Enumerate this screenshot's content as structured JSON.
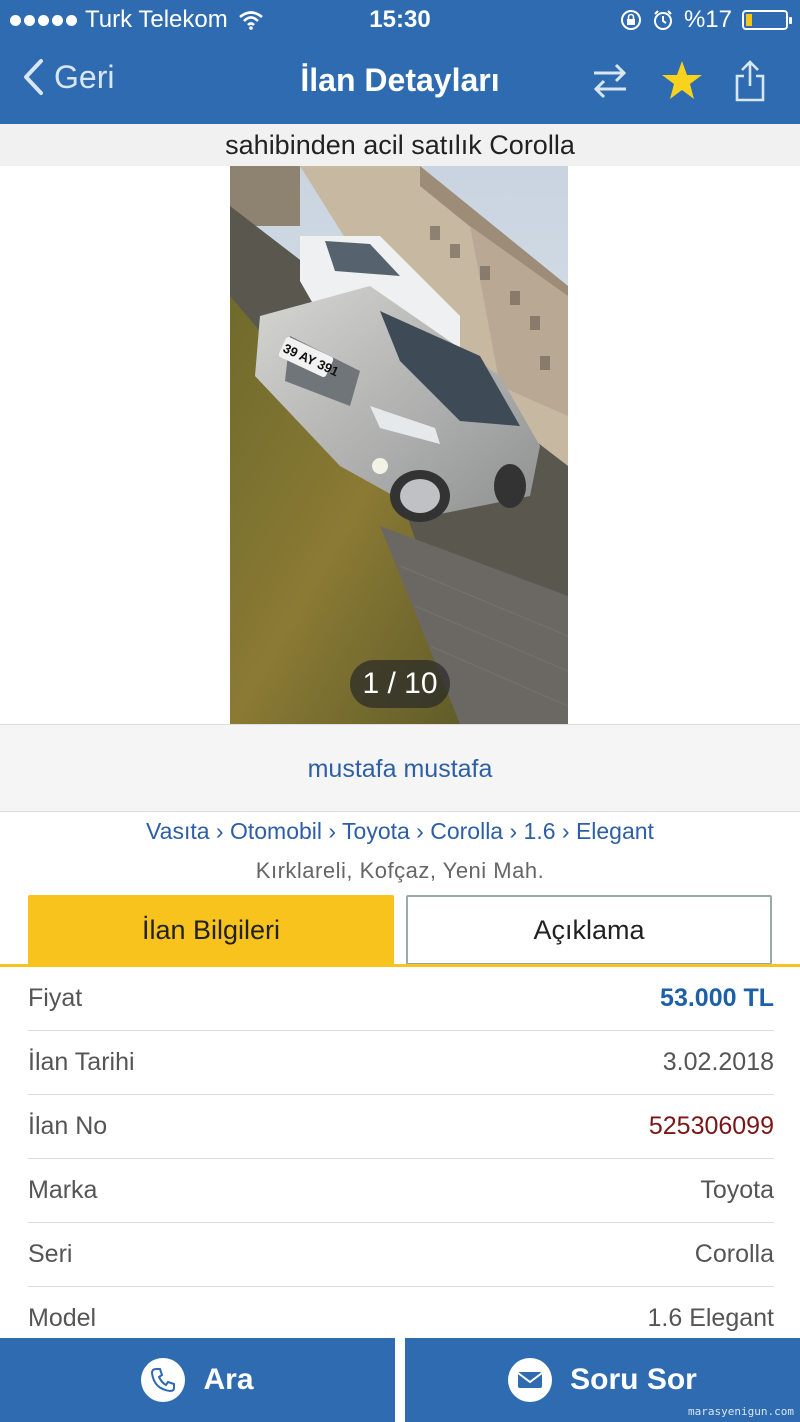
{
  "status_bar": {
    "carrier": "Turk Telekom",
    "time": "15:30",
    "battery_text": "%17",
    "battery_level": 0.17
  },
  "nav": {
    "back_label": "Geri",
    "title": "İlan Detayları",
    "icons": [
      "swap-icon",
      "star-icon",
      "share-icon"
    ]
  },
  "listing": {
    "title": "sahibinden acil satılık Corolla",
    "photo_counter": "1 / 10",
    "seller": "mustafa mustafa",
    "breadcrumb": "Vasıta › Otomobil › Toyota › Corolla › 1.6 › Elegant",
    "location": "Kırklareli, Kofçaz, Yeni Mah.",
    "plate": "39 AY 391"
  },
  "tabs": [
    {
      "label": "İlan Bilgileri",
      "active": true
    },
    {
      "label": "Açıklama",
      "active": false
    }
  ],
  "info": [
    {
      "key": "Fiyat",
      "value": "53.000 TL"
    },
    {
      "key": "İlan Tarihi",
      "value": "3.02.2018"
    },
    {
      "key": "İlan No",
      "value": "525306099"
    },
    {
      "key": "Marka",
      "value": "Toyota"
    },
    {
      "key": "Seri",
      "value": "Corolla"
    },
    {
      "key": "Model",
      "value": "1.6 Elegant"
    }
  ],
  "actions": {
    "call_label": "Ara",
    "ask_label": "Soru Sor"
  },
  "watermark": "marasyenigun.com",
  "colors": {
    "primary": "#2e6bb0",
    "accent": "#f9c31d",
    "price": "#1d5fa8",
    "listing_no": "#7a1616"
  }
}
